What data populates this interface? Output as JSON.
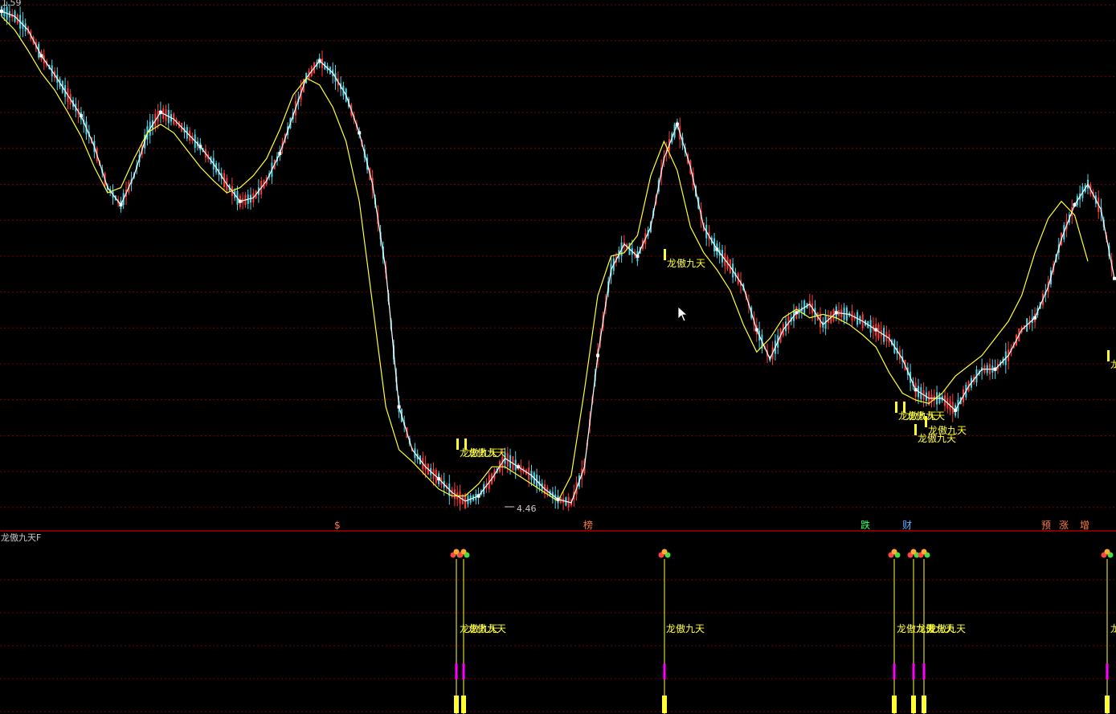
{
  "colors": {
    "background": "#000000",
    "grid": "#7a0000",
    "separator": "#b00000",
    "up_candle": "#ff3c3c",
    "down_candle": "#4fd6e6",
    "ma_fast": "#ffffff",
    "ma_slow": "#ffff33",
    "signal_text": "#ffff33",
    "label_text": "#c8c8c8",
    "stem_magenta": "#ff00ff"
  },
  "main_panel": {
    "top_price_label": "1.59",
    "low_price_label": "4.46",
    "cursor_icon": "mouse-pointer-icon"
  },
  "markers": [
    {
      "text": "$",
      "color": "#ff7a3c"
    },
    {
      "text": "榜",
      "color": "#ff7a3c"
    },
    {
      "text": "跌",
      "color": "#33ff66"
    },
    {
      "text": "财",
      "color": "#66aaff"
    },
    {
      "text": "预",
      "color": "#ff7a3c"
    },
    {
      "text": "涨",
      "color": "#ff7a3c"
    },
    {
      "text": "增",
      "color": "#ff7a3c"
    }
  ],
  "signal_labels_main": [
    "龙傲九天",
    "龙傲九天",
    "龙傲九天",
    "龙傲九天",
    "龙傲九天",
    "龙傲九天",
    "龙傲九天",
    "龙"
  ],
  "indicator_panel": {
    "title": "龙傲九天F",
    "signal_labels": [
      "龙傲九天",
      "龙傲九天",
      "龙傲九天",
      "龙傲九天",
      "龙傲九天",
      "龙傲九天",
      "龙"
    ]
  },
  "chart_data": {
    "type": "line",
    "series": [
      {
        "values": [
          1.59,
          1.62,
          1.7,
          1.85,
          1.96,
          2.08,
          2.2,
          2.38,
          2.62,
          2.72,
          2.55,
          2.3,
          2.18,
          2.22,
          2.3,
          2.38,
          2.48,
          2.6,
          2.7,
          2.68,
          2.58,
          2.42,
          2.2,
          1.98,
          1.88,
          1.95,
          2.08,
          2.3,
          2.6,
          3.1,
          3.9,
          4.15,
          4.25,
          4.32,
          4.4,
          4.45,
          4.42,
          4.32,
          4.2,
          4.25,
          4.3,
          4.38,
          4.44,
          4.46,
          4.25,
          3.6,
          3.1,
          2.95,
          3.02,
          2.85,
          2.45,
          2.25,
          2.5,
          2.85,
          2.98,
          3.08,
          3.2,
          3.45,
          3.62,
          3.45,
          3.35,
          3.3,
          3.42,
          3.35,
          3.36,
          3.4,
          3.45,
          3.5,
          3.62,
          3.8,
          3.85,
          3.85,
          3.92,
          3.78,
          3.68,
          3.68,
          3.6,
          3.45,
          3.38,
          3.2,
          2.92,
          2.72,
          2.6,
          2.75,
          3.15
        ]
      },
      {
        "values": [
          1.62,
          1.7,
          1.82,
          1.95,
          2.05,
          2.18,
          2.32,
          2.5,
          2.65,
          2.62,
          2.45,
          2.3,
          2.25,
          2.3,
          2.4,
          2.5,
          2.58,
          2.65,
          2.62,
          2.55,
          2.45,
          2.28,
          2.08,
          1.98,
          2.02,
          2.15,
          2.35,
          2.7,
          3.3,
          3.9,
          4.15,
          4.22,
          4.3,
          4.38,
          4.42,
          4.42,
          4.35,
          4.25,
          4.25,
          4.3,
          4.35,
          4.4,
          4.45,
          4.3,
          3.8,
          3.25,
          3.02,
          3.0,
          2.9,
          2.55,
          2.35,
          2.52,
          2.85,
          3.0,
          3.1,
          3.22,
          3.42,
          3.58,
          3.5,
          3.38,
          3.33,
          3.38,
          3.36,
          3.38,
          3.42,
          3.48,
          3.55,
          3.7,
          3.82,
          3.86,
          3.88,
          3.82,
          3.72,
          3.66,
          3.6,
          3.5,
          3.4,
          3.25,
          3.0,
          2.8,
          2.7,
          2.78,
          3.05
        ]
      }
    ]
  }
}
